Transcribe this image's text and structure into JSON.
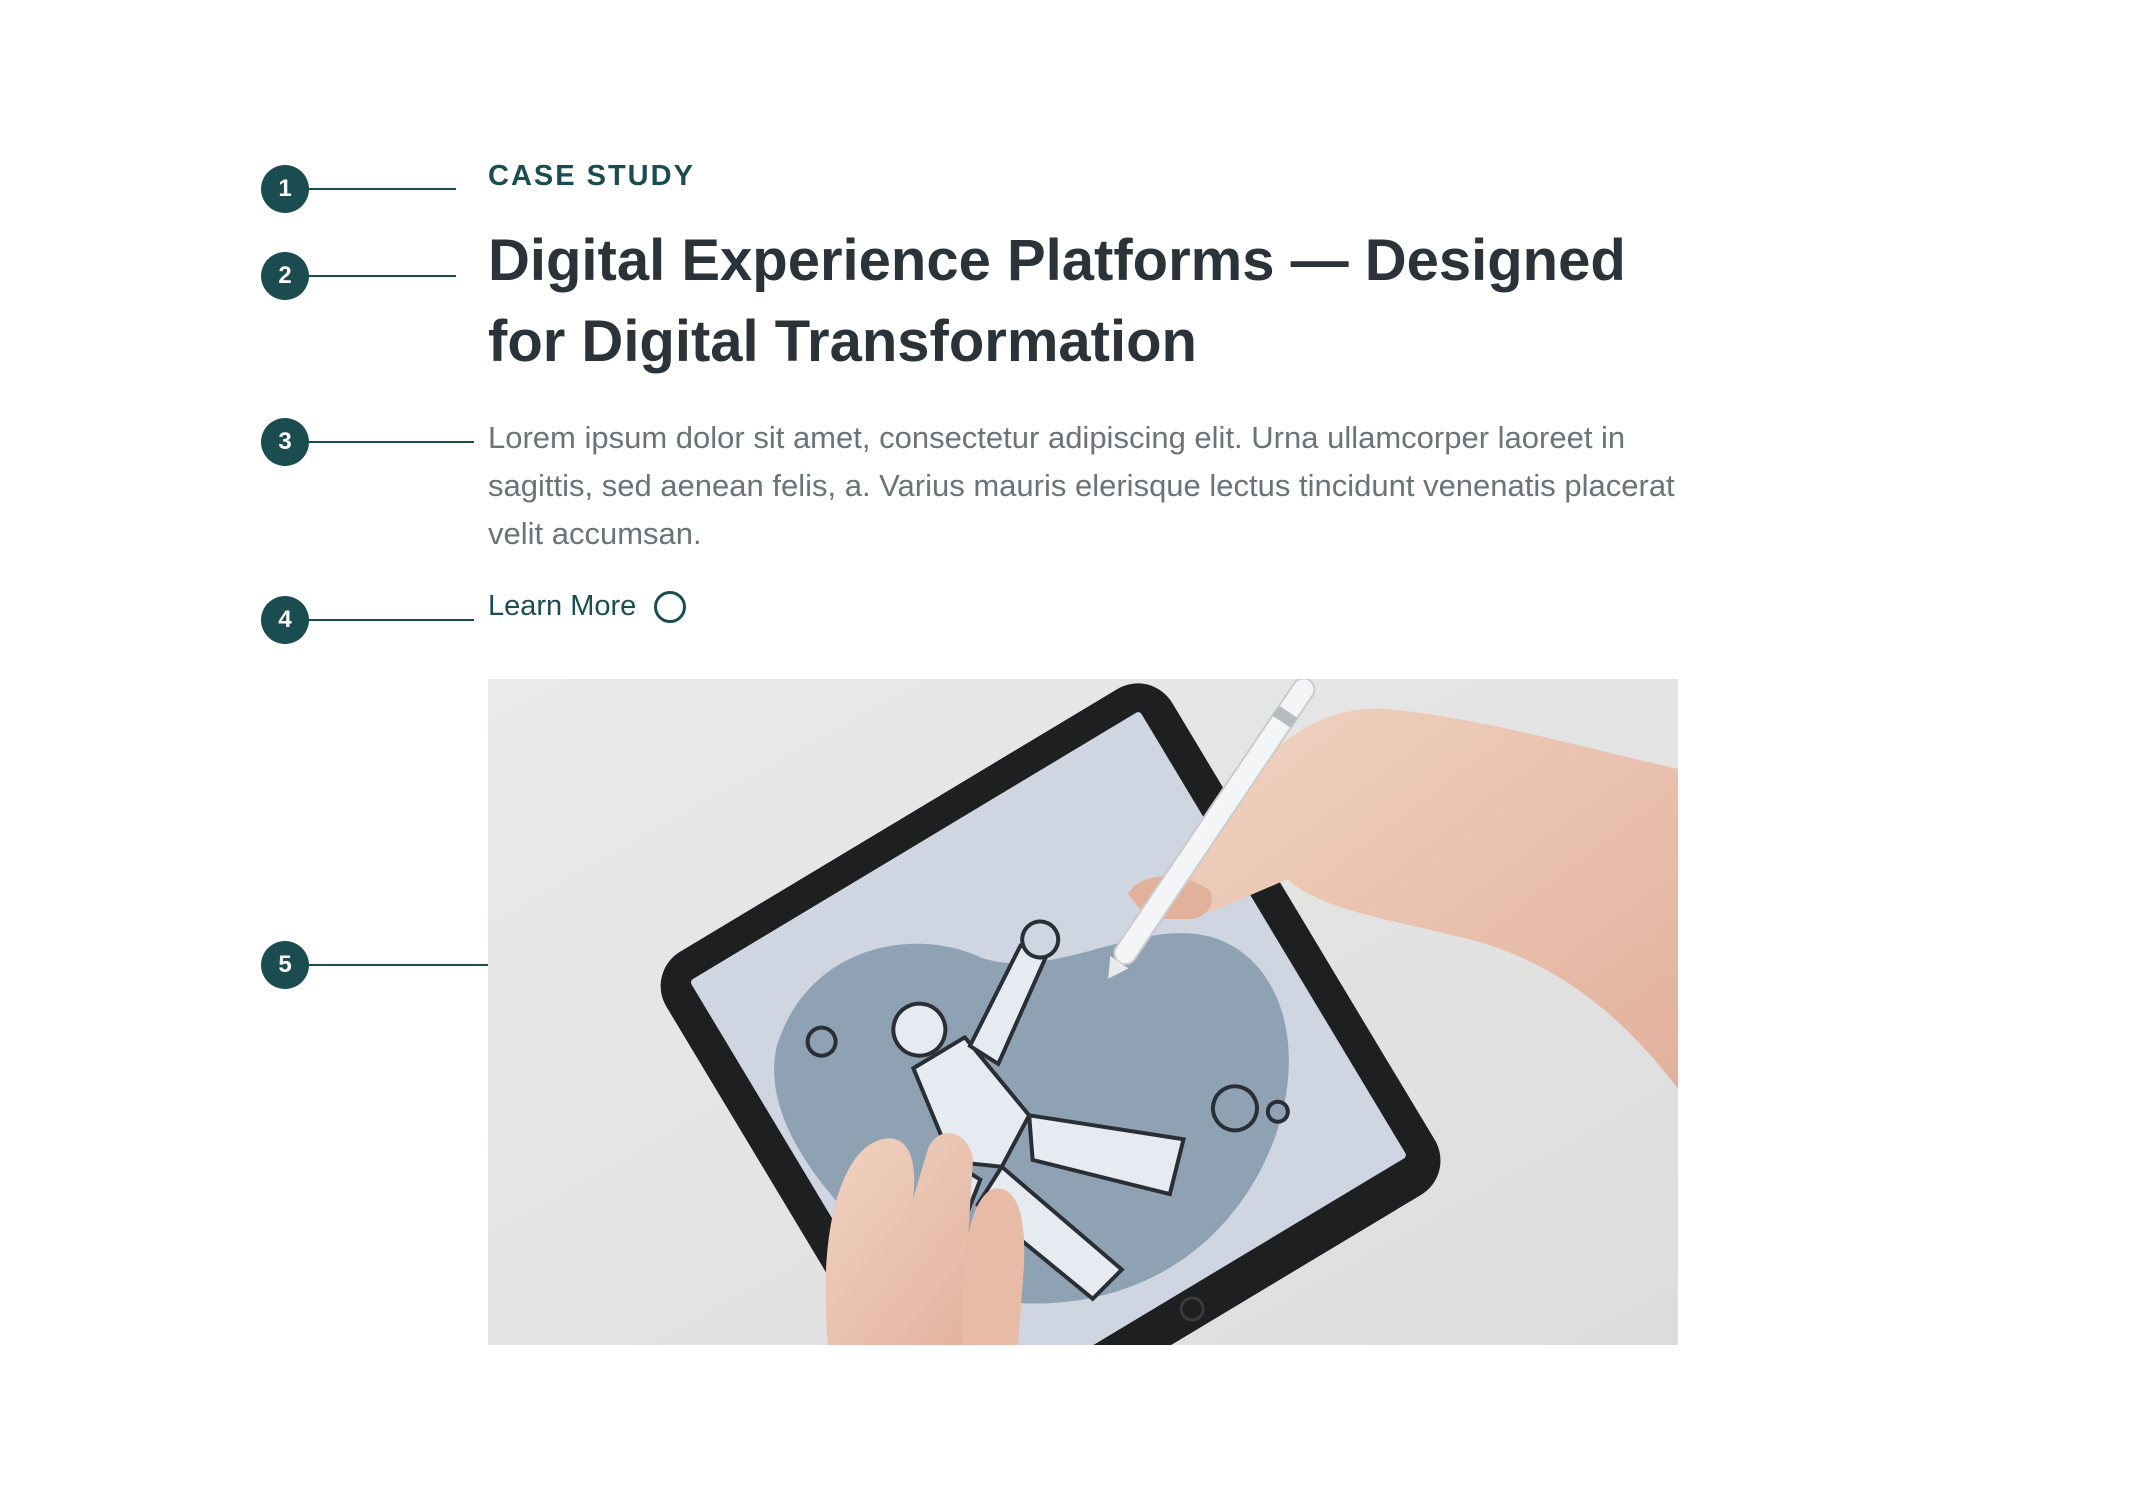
{
  "markers": [
    "1",
    "2",
    "3",
    "4",
    "5"
  ],
  "eyebrow": "CASE STUDY",
  "headline": {
    "line1": "Digital Experience Platforms — Designed",
    "line2": "for Digital Transformation"
  },
  "body": "Lorem ipsum dolor sit amet, consectetur adipiscing elit. Urna ullamcorper laoreet in sagittis, sed aenean felis, a. Varius mauris elerisque lectus tincidunt venenatis placerat velit accumsan.",
  "cta": {
    "label": "Learn More",
    "icon": "circle-icon"
  },
  "hero_image": {
    "subject": "hands-drawing-on-tablet-with-stylus-photo"
  },
  "colors": {
    "accent": "#1b4d50",
    "heading": "#2b3338",
    "body": "#6b7378",
    "background": "#ffffff"
  }
}
